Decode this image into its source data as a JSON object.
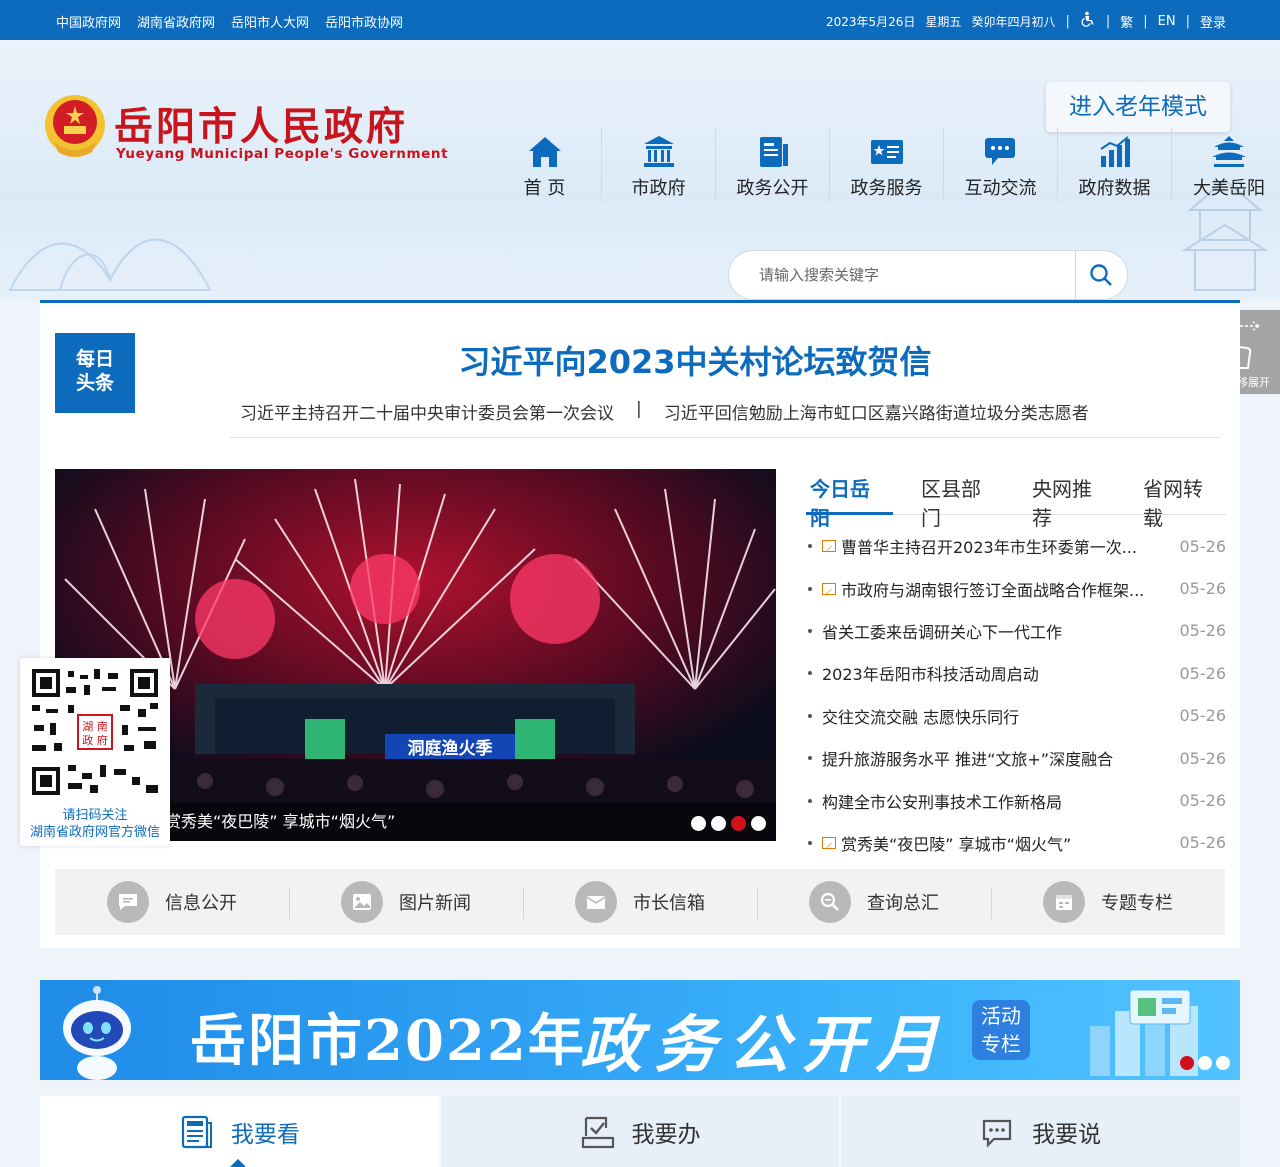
{
  "topbar": {
    "links": [
      "中国政府网",
      "湖南省政府网",
      "岳阳市人大网",
      "岳阳市政协网"
    ],
    "date": "2023年5月26日",
    "weekday": "星期五",
    "lunar": "癸卯年四月初八",
    "traditional": "繁",
    "english": "EN",
    "login": "登录"
  },
  "header": {
    "logo_cn": "岳阳市人民政府",
    "logo_en": "Yueyang Municipal People's Government",
    "elder_mode": "进入老年模式",
    "nav": [
      {
        "label": "首 页",
        "icon": "home-icon"
      },
      {
        "label": "市政府",
        "icon": "government-building-icon"
      },
      {
        "label": "政务公开",
        "icon": "document-icon"
      },
      {
        "label": "政务服务",
        "icon": "service-card-icon"
      },
      {
        "label": "互动交流",
        "icon": "chat-icon"
      },
      {
        "label": "政府数据",
        "icon": "bar-chart-icon"
      },
      {
        "label": "大美岳阳",
        "icon": "pavilion-icon"
      }
    ],
    "search_placeholder": "请输入搜索关键字"
  },
  "headline": {
    "badge_line1": "每日",
    "badge_line2": "头条",
    "title": "习近平向2023中关村论坛致贺信",
    "sub1": "习近平主持召开二十届中央审计委员会第一次会议",
    "sep": "|",
    "sub2": "习近平回信勉励上海市虹口区嘉兴路街道垃圾分类志愿者"
  },
  "slider": {
    "caption": "赏秀美“夜巴陵” 享城市“烟火气”",
    "stage_sign": "洞庭渔火季",
    "dots": 4,
    "active_dot": 3
  },
  "news_tabs": [
    "今日岳阳",
    "区县部门",
    "央网推荐",
    "省网转载"
  ],
  "news": [
    {
      "title": "曹普华主持召开2023年市生环委第一次...",
      "date": "05-26",
      "pic": true
    },
    {
      "title": "市政府与湖南银行签订全面战略合作框架...",
      "date": "05-26",
      "pic": true
    },
    {
      "title": "省关工委来岳调研关心下一代工作",
      "date": "05-26",
      "pic": false
    },
    {
      "title": "2023年岳阳市科技活动周启动",
      "date": "05-26",
      "pic": false
    },
    {
      "title": "交往交流交融 志愿快乐同行",
      "date": "05-26",
      "pic": false
    },
    {
      "title": "提升旅游服务水平 推进“文旅+”深度融合",
      "date": "05-26",
      "pic": false
    },
    {
      "title": "构建全市公安刑事技术工作新格局",
      "date": "05-26",
      "pic": false
    },
    {
      "title": "赏秀美“夜巴陵” 享城市“烟火气”",
      "date": "05-26",
      "pic": true
    }
  ],
  "qr": {
    "line1": "请扫码关注",
    "line2": "湖南省政府网官方微信"
  },
  "quick": [
    {
      "label": "信息公开",
      "icon": "chat-bubble-icon"
    },
    {
      "label": "图片新闻",
      "icon": "image-icon"
    },
    {
      "label": "市长信箱",
      "icon": "mail-icon"
    },
    {
      "label": "查询总汇",
      "icon": "search-list-icon"
    },
    {
      "label": "专题专栏",
      "icon": "calendar-icon"
    }
  ],
  "side_float": {
    "text": "鼠标右移展开"
  },
  "banner": {
    "part1": "岳阳市2022年",
    "part2": "政务公开月",
    "tag_line1": "活动",
    "tag_line2": "专栏",
    "dots": 3,
    "active_dot": 1
  },
  "bottom_tabs": [
    "我要看",
    "我要办",
    "我要说"
  ],
  "colors": {
    "primary": "#0d6bbd",
    "logo_red": "#c8141c",
    "active_dot": "#d0101a"
  }
}
